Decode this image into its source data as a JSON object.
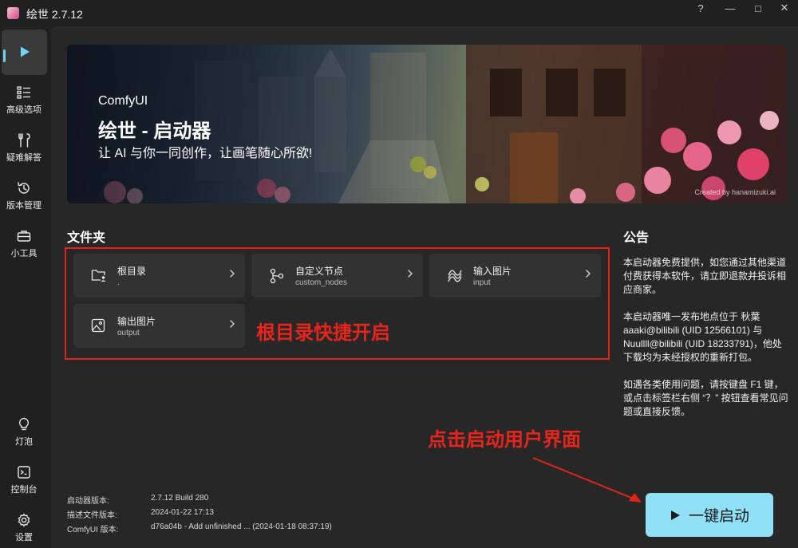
{
  "window": {
    "title": "绘世 2.7.12",
    "controls": {
      "help": "?",
      "minimize": "—",
      "maximize": "□",
      "close": "✕"
    }
  },
  "sidebar": {
    "items": [
      {
        "label": "",
        "icon": "play-icon"
      },
      {
        "label": "高级选项",
        "icon": "list-settings-icon"
      },
      {
        "label": "疑难解答",
        "icon": "tools-icon"
      },
      {
        "label": "版本管理",
        "icon": "history-icon"
      },
      {
        "label": "小工具",
        "icon": "toolbox-icon"
      },
      {
        "label": "灯泡",
        "icon": "lightbulb-icon"
      },
      {
        "label": "控制台",
        "icon": "console-icon"
      },
      {
        "label": "设置",
        "icon": "gear-icon"
      }
    ],
    "accent_color": "#6fd3f5"
  },
  "banner": {
    "subtitle": "ComfyUI",
    "title": "绘世 - 启动器",
    "slogan": "让 AI 与你一同创作，让画笔随心所欲!",
    "credit": "Created by hanamizuki.ai"
  },
  "folders": {
    "title": "文件夹",
    "items": [
      {
        "name": "根目录",
        "path": ".",
        "icon": "folder-user-icon"
      },
      {
        "name": "自定义节点",
        "path": "custom_nodes",
        "icon": "branch-icon"
      },
      {
        "name": "输入图片",
        "path": "input",
        "icon": "input-wave-icon"
      },
      {
        "name": "输出图片",
        "path": "output",
        "icon": "image-icon"
      }
    ]
  },
  "annotations": {
    "folders_note": "根目录快捷开启",
    "launch_note": "点击启动用户界面",
    "color": "#e2231a"
  },
  "notice": {
    "title": "公告",
    "paragraphs": [
      "本启动器免费提供，如您通过其他渠道付费获得本软件，请立即退款并投诉相应商家。",
      "本启动器唯一发布地点位于 秋葉aaaki@bilibili (UID 12566101) 与 Nuullll@bilibili (UID 18233791)，他处下载均为未经授权的重新打包。",
      "如遇各类使用问题，请按键盘 F1 键，或点击标签栏右侧 “？” 按钮查看常见问题或直接反馈。"
    ]
  },
  "version_info": [
    {
      "key": "启动器版本:",
      "value": "2.7.12 Build 280"
    },
    {
      "key": "描述文件版本:",
      "value": "2024-01-22 17:13"
    },
    {
      "key": "ComfyUI 版本:",
      "value": "d76a04b - Add unfinished ... (2024-01-18 08:37:19)"
    }
  ],
  "launch": {
    "label": "一键启动",
    "icon": "play-icon",
    "color": "#8fe0f4"
  }
}
